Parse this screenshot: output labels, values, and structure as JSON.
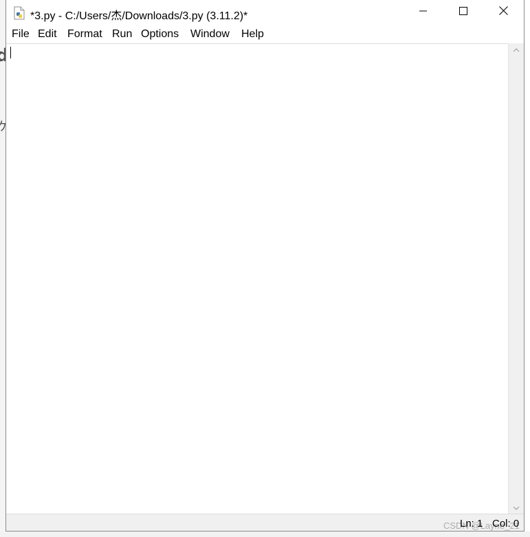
{
  "window": {
    "title": "*3.py - C:/Users/杰/Downloads/3.py (3.11.2)*",
    "icon": "python-file-icon"
  },
  "window_controls": {
    "minimize_icon": "minimize-icon",
    "maximize_icon": "maximize-icon",
    "close_icon": "close-icon"
  },
  "menu": {
    "items": [
      {
        "label": "File"
      },
      {
        "label": "Edit"
      },
      {
        "label": "Format"
      },
      {
        "label": "Run"
      },
      {
        "label": "Options"
      },
      {
        "label": "Window"
      },
      {
        "label": "Help"
      }
    ]
  },
  "editor": {
    "content": ""
  },
  "statusbar": {
    "line": "Ln: 1",
    "column": "Col: 0"
  },
  "watermark": "CSDN @Layne_21",
  "colors": {
    "window_bg": "#ffffff",
    "chrome_bg": "#f0f0f0",
    "border": "#8a8a8a"
  }
}
